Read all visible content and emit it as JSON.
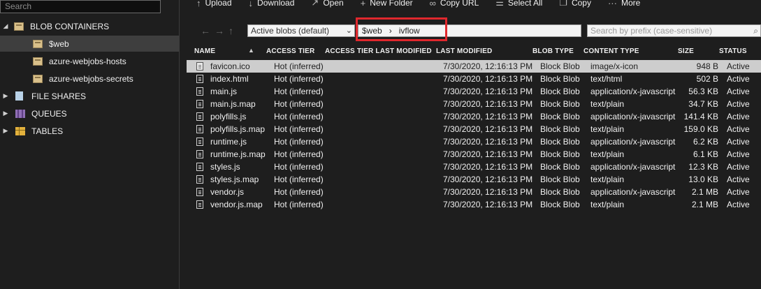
{
  "sidebar": {
    "search_placeholder": "Search",
    "blob_containers_label": "BLOB CONTAINERS",
    "containers": [
      "$web",
      "azure-webjobs-hosts",
      "azure-webjobs-secrets"
    ],
    "file_shares_label": "FILE SHARES",
    "queues_label": "QUEUES",
    "tables_label": "TABLES"
  },
  "toolbar": {
    "upload": "Upload",
    "download": "Download",
    "open": "Open",
    "new_folder": "New Folder",
    "copy_url": "Copy URL",
    "select_all": "Select All",
    "copy": "Copy",
    "more": "More"
  },
  "address": {
    "filter_value": "Active blobs (default)",
    "path_container": "$web",
    "path_separator": "›",
    "path_folder": "ivflow",
    "prefix_placeholder": "Search by prefix (case-sensitive)",
    "highlight_color": "#e0282d"
  },
  "table": {
    "headers": {
      "name": "NAME",
      "access_tier": "ACCESS TIER",
      "access_tier_modified": "ACCESS TIER LAST MODIFIED",
      "last_modified": "LAST MODIFIED",
      "blob_type": "BLOB TYPE",
      "content_type": "CONTENT TYPE",
      "size": "SIZE",
      "status": "STATUS"
    },
    "rows": [
      {
        "name": "favicon.ico",
        "tier": "Hot (inferred)",
        "modified": "7/30/2020, 12:16:13 PM",
        "type": "Block Blob",
        "content": "image/x-icon",
        "size": "948 B",
        "status": "Active"
      },
      {
        "name": "index.html",
        "tier": "Hot (inferred)",
        "modified": "7/30/2020, 12:16:13 PM",
        "type": "Block Blob",
        "content": "text/html",
        "size": "502 B",
        "status": "Active"
      },
      {
        "name": "main.js",
        "tier": "Hot (inferred)",
        "modified": "7/30/2020, 12:16:13 PM",
        "type": "Block Blob",
        "content": "application/x-javascript",
        "size": "56.3 KB",
        "status": "Active"
      },
      {
        "name": "main.js.map",
        "tier": "Hot (inferred)",
        "modified": "7/30/2020, 12:16:13 PM",
        "type": "Block Blob",
        "content": "text/plain",
        "size": "34.7 KB",
        "status": "Active"
      },
      {
        "name": "polyfills.js",
        "tier": "Hot (inferred)",
        "modified": "7/30/2020, 12:16:13 PM",
        "type": "Block Blob",
        "content": "application/x-javascript",
        "size": "141.4 KB",
        "status": "Active"
      },
      {
        "name": "polyfills.js.map",
        "tier": "Hot (inferred)",
        "modified": "7/30/2020, 12:16:13 PM",
        "type": "Block Blob",
        "content": "text/plain",
        "size": "159.0 KB",
        "status": "Active"
      },
      {
        "name": "runtime.js",
        "tier": "Hot (inferred)",
        "modified": "7/30/2020, 12:16:13 PM",
        "type": "Block Blob",
        "content": "application/x-javascript",
        "size": "6.2 KB",
        "status": "Active"
      },
      {
        "name": "runtime.js.map",
        "tier": "Hot (inferred)",
        "modified": "7/30/2020, 12:16:13 PM",
        "type": "Block Blob",
        "content": "text/plain",
        "size": "6.1 KB",
        "status": "Active"
      },
      {
        "name": "styles.js",
        "tier": "Hot (inferred)",
        "modified": "7/30/2020, 12:16:13 PM",
        "type": "Block Blob",
        "content": "application/x-javascript",
        "size": "12.3 KB",
        "status": "Active"
      },
      {
        "name": "styles.js.map",
        "tier": "Hot (inferred)",
        "modified": "7/30/2020, 12:16:13 PM",
        "type": "Block Blob",
        "content": "text/plain",
        "size": "13.0 KB",
        "status": "Active"
      },
      {
        "name": "vendor.js",
        "tier": "Hot (inferred)",
        "modified": "7/30/2020, 12:16:13 PM",
        "type": "Block Blob",
        "content": "application/x-javascript",
        "size": "2.1 MB",
        "status": "Active"
      },
      {
        "name": "vendor.js.map",
        "tier": "Hot (inferred)",
        "modified": "7/30/2020, 12:16:13 PM",
        "type": "Block Blob",
        "content": "text/plain",
        "size": "2.1 MB",
        "status": "Active"
      }
    ]
  }
}
